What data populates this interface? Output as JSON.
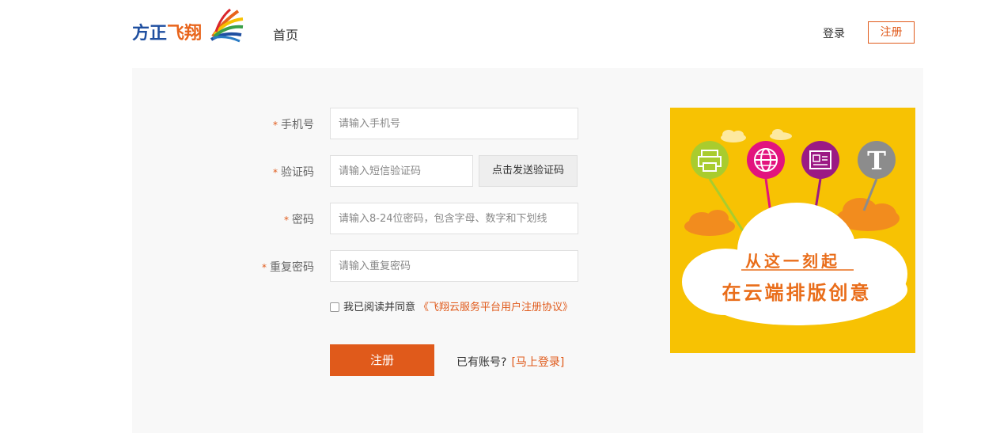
{
  "header": {
    "logo_text_main": "方正",
    "logo_text_accent": "飞翔",
    "nav_home": "首页",
    "login": "登录",
    "register": "注册"
  },
  "form": {
    "required_mark": "*",
    "phone": {
      "label": "手机号",
      "placeholder": "请输入手机号"
    },
    "code": {
      "label": "验证码",
      "placeholder": "请输入短信验证码",
      "send_button": "点击发送验证码"
    },
    "password": {
      "label": "密码",
      "placeholder": "请输入8-24位密码，包含字母、数字和下划线"
    },
    "confirm": {
      "label": "重复密码",
      "placeholder": "请输入重复密码"
    },
    "agree_text": "我已阅读并同意",
    "agreement_link": "《飞翔云服务平台用户注册协议》",
    "agree_checked": false,
    "submit": "注册",
    "has_account": "已有账号?",
    "login_now": "[马上登录]"
  },
  "banner": {
    "line1": "从这一刻起",
    "line2": "在云端排版创意",
    "icons": [
      "printer-icon",
      "globe-icon",
      "document-icon",
      "text-icon"
    ],
    "colors": {
      "background": "#f7c203",
      "printer": "#a9cc2e",
      "globe": "#e2137e",
      "document": "#9b1a84",
      "text": "#8c8c8c",
      "text_accent": "#e96d1a"
    }
  },
  "colors": {
    "accent": "#e05a1b",
    "brand_blue": "#1f4fa0",
    "panel_bg": "#f8f8f8"
  }
}
